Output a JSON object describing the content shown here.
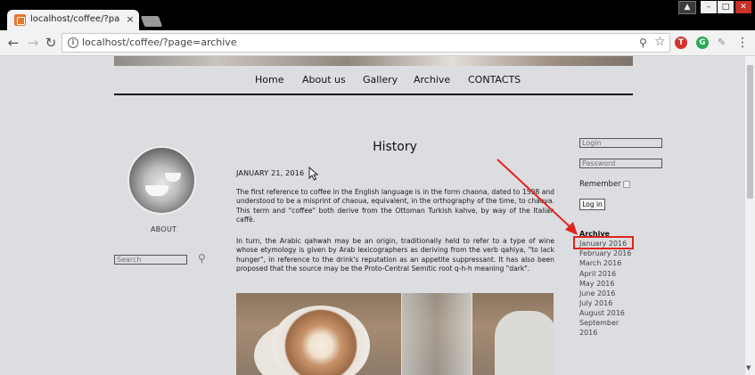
{
  "browser": {
    "tab_title": "localhost/coffee/?page=arc",
    "tab_close": "×",
    "url": "localhost/coffee/?page=archive",
    "back_glyph": "←",
    "forward_glyph": "→",
    "reload_glyph": "↻",
    "info_glyph": "i",
    "zoom_glyph": "⚲",
    "star_glyph": "☆",
    "ext_t": "T",
    "ext_g": "G",
    "pin_glyph": "✎",
    "menu_glyph": "⋮",
    "profile_glyph": "▲",
    "win_min": "–",
    "win_max": "□",
    "win_close": "✕"
  },
  "nav": {
    "home": "Home",
    "about": "About us",
    "gallery": "Gallery",
    "archive": "Archive",
    "contacts": "CONTACTS"
  },
  "sidebar_left": {
    "about_label": "ABOUT",
    "search_placeholder": "Search",
    "search_glyph": "⚲"
  },
  "post": {
    "title": "History",
    "date": "JANUARY 21, 2016",
    "paragraphs": [
      "The first reference to coffee in the English language is in the form chaona, dated to 1598 and understood to be a misprint of chaoua, equivalent, in the orthography of the time, to chaova. This term and \"coffee\" both derive from the Ottoman Turkish kahve, by way of the Italian caffè.",
      "In turn, the Arabic qahwah may be an origin, traditionally held to refer to a type of wine whose etymology is given by Arab lexicographers as deriving from the verb qahiya, \"to lack hunger\", in reference to the drink's reputation as an appetite suppressant. It has also been proposed that the source may be the Proto-Central Semitic root q-h-h meaning \"dark\"."
    ]
  },
  "sidebar_right": {
    "login_placeholder": "Login",
    "password_placeholder": "Password",
    "remember_label": "Remember",
    "login_button": "Log in",
    "archive_heading": "Archive",
    "archive_links": [
      "January 2016",
      "February 2016",
      "March 2016",
      "April 2016",
      "May 2016",
      "June 2016",
      "July 2016",
      "August 2016",
      "September",
      "2016"
    ]
  },
  "colors": {
    "annotation": "#e0231e",
    "page_background": "#dcdde0",
    "browser_chrome": "#000000"
  }
}
